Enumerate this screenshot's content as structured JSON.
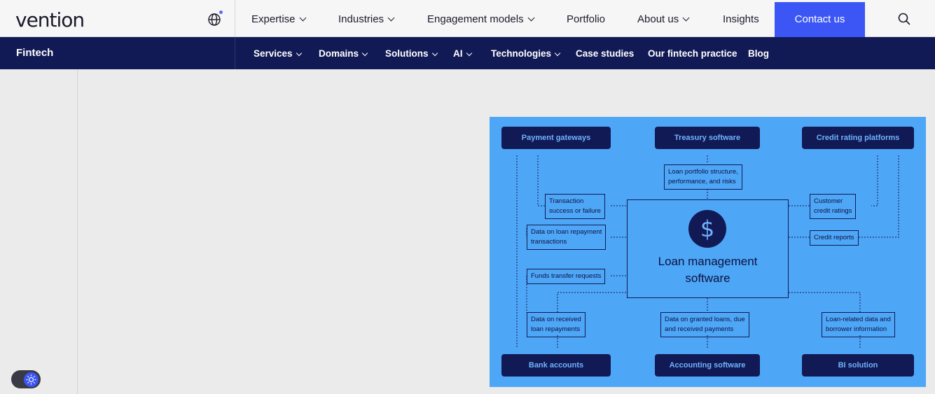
{
  "brand": {
    "logo": "vention"
  },
  "topnav": {
    "items": [
      {
        "label": "Expertise",
        "dropdown": true
      },
      {
        "label": "Industries",
        "dropdown": true
      },
      {
        "label": "Engagement models",
        "dropdown": true
      },
      {
        "label": "Portfolio",
        "dropdown": false
      },
      {
        "label": "About us",
        "dropdown": true
      },
      {
        "label": "Insights",
        "dropdown": false
      }
    ],
    "contact_label": "Contact us",
    "icons": {
      "language": "globe-icon",
      "search": "search-icon"
    }
  },
  "subnav": {
    "title": "Fintech",
    "items": [
      {
        "label": "Services",
        "dropdown": true
      },
      {
        "label": "Domains",
        "dropdown": true
      },
      {
        "label": "Solutions",
        "dropdown": true
      },
      {
        "label": "AI",
        "dropdown": true
      },
      {
        "label": "Technologies",
        "dropdown": true
      },
      {
        "label": "Case studies",
        "dropdown": false
      },
      {
        "label": "Our fintech practice",
        "dropdown": false
      },
      {
        "label": "Blog",
        "dropdown": false
      }
    ]
  },
  "diagram": {
    "center": {
      "title_line1": "Loan management",
      "title_line2": "software",
      "icon": "dollar-icon"
    },
    "nodes": {
      "payment": "Payment gateways",
      "treasury": "Treasury software",
      "credit_rating": "Credit rating platforms",
      "bank": "Bank accounts",
      "accounting": "Accounting software",
      "bi": "BI solution"
    },
    "labels": {
      "portfolio_1": "Loan portfolio structure,",
      "portfolio_2": "performance, and risks",
      "transaction_1": "Transaction",
      "transaction_2": "success or failure",
      "repayment_tx_1": "Data on loan repayment",
      "repayment_tx_2": "transactions",
      "funds": "Funds transfer requests",
      "received_1": "Data on received",
      "received_2": "loan repayments",
      "granted_1": "Data on granted loans, due",
      "granted_2": "and received payments",
      "customer_1": "Customer",
      "customer_2": "credit ratings",
      "credit_reports": "Credit reports",
      "loan_related_1": "Loan-related data and",
      "loan_related_2": "borrower information"
    }
  },
  "colors": {
    "navy": "#111a55",
    "accent": "#3b56f5",
    "diagram_bg": "#4ea6f7"
  },
  "theme_toggle": {
    "icon": "sun-icon"
  }
}
